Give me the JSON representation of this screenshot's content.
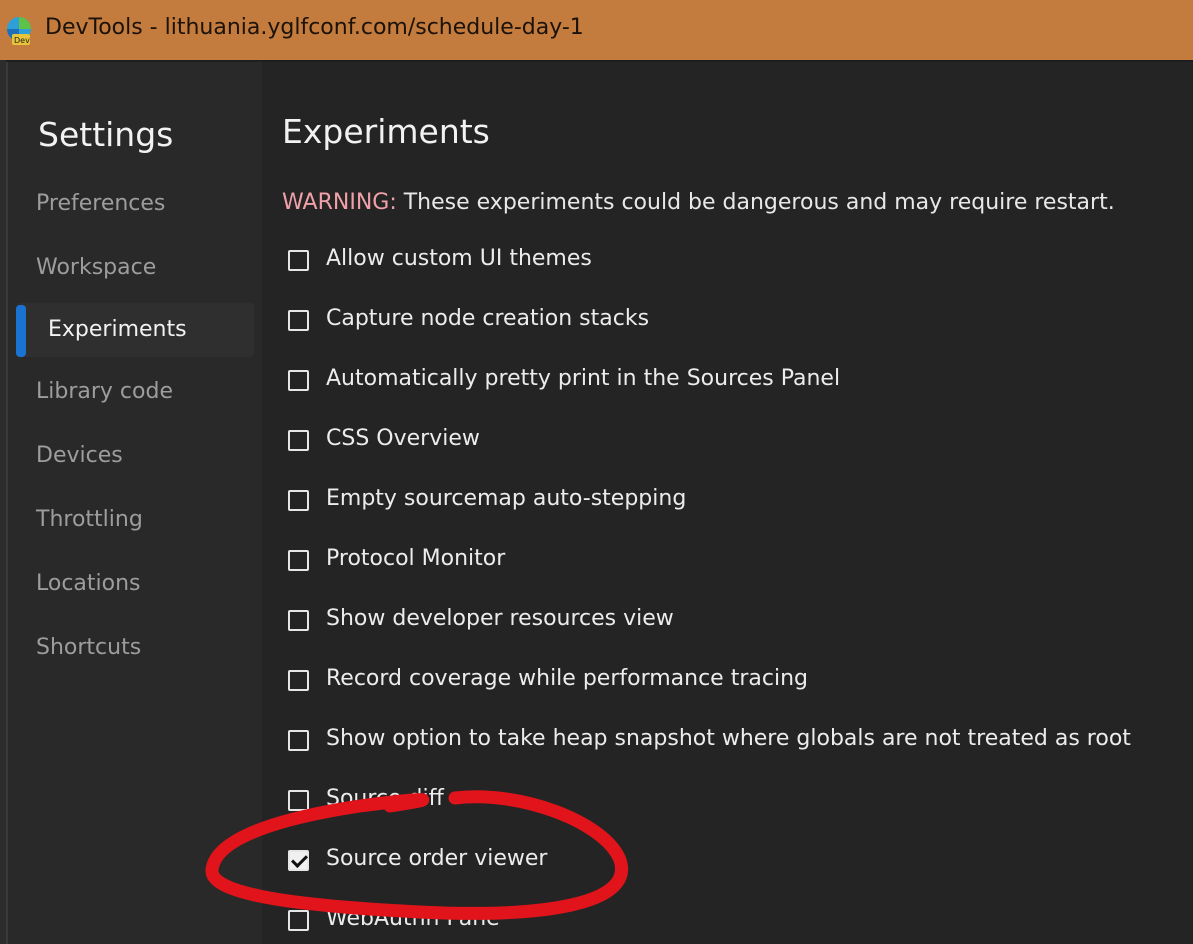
{
  "window": {
    "title": "DevTools - lithuania.yglfconf.com/schedule-day-1"
  },
  "sidebar": {
    "title": "Settings",
    "items": [
      {
        "label": "Preferences",
        "selected": false
      },
      {
        "label": "Workspace",
        "selected": false
      },
      {
        "label": "Experiments",
        "selected": true
      },
      {
        "label": "Library code",
        "selected": false
      },
      {
        "label": "Devices",
        "selected": false
      },
      {
        "label": "Throttling",
        "selected": false
      },
      {
        "label": "Locations",
        "selected": false
      },
      {
        "label": "Shortcuts",
        "selected": false
      }
    ]
  },
  "main": {
    "title": "Experiments",
    "warning_tag": "WARNING:",
    "warning_text": " These experiments could be dangerous and may require restart.",
    "experiments": [
      {
        "label": "Allow custom UI themes",
        "checked": false
      },
      {
        "label": "Capture node creation stacks",
        "checked": false
      },
      {
        "label": "Automatically pretty print in the Sources Panel",
        "checked": false
      },
      {
        "label": "CSS Overview",
        "checked": false
      },
      {
        "label": "Empty sourcemap auto-stepping",
        "checked": false
      },
      {
        "label": "Protocol Monitor",
        "checked": false
      },
      {
        "label": "Show developer resources view",
        "checked": false
      },
      {
        "label": "Record coverage while performance tracing",
        "checked": false
      },
      {
        "label": "Show option to take heap snapshot where globals are not treated as root",
        "checked": false
      },
      {
        "label": "Source diff",
        "checked": false
      },
      {
        "label": "Source order viewer",
        "checked": true
      },
      {
        "label": "WebAuthn Pane",
        "checked": false
      }
    ]
  },
  "colors": {
    "accent": "#1a73d1",
    "titlebar": "#c47b3e",
    "warning": "#f0a0a8",
    "annotation": "#e0141a"
  }
}
